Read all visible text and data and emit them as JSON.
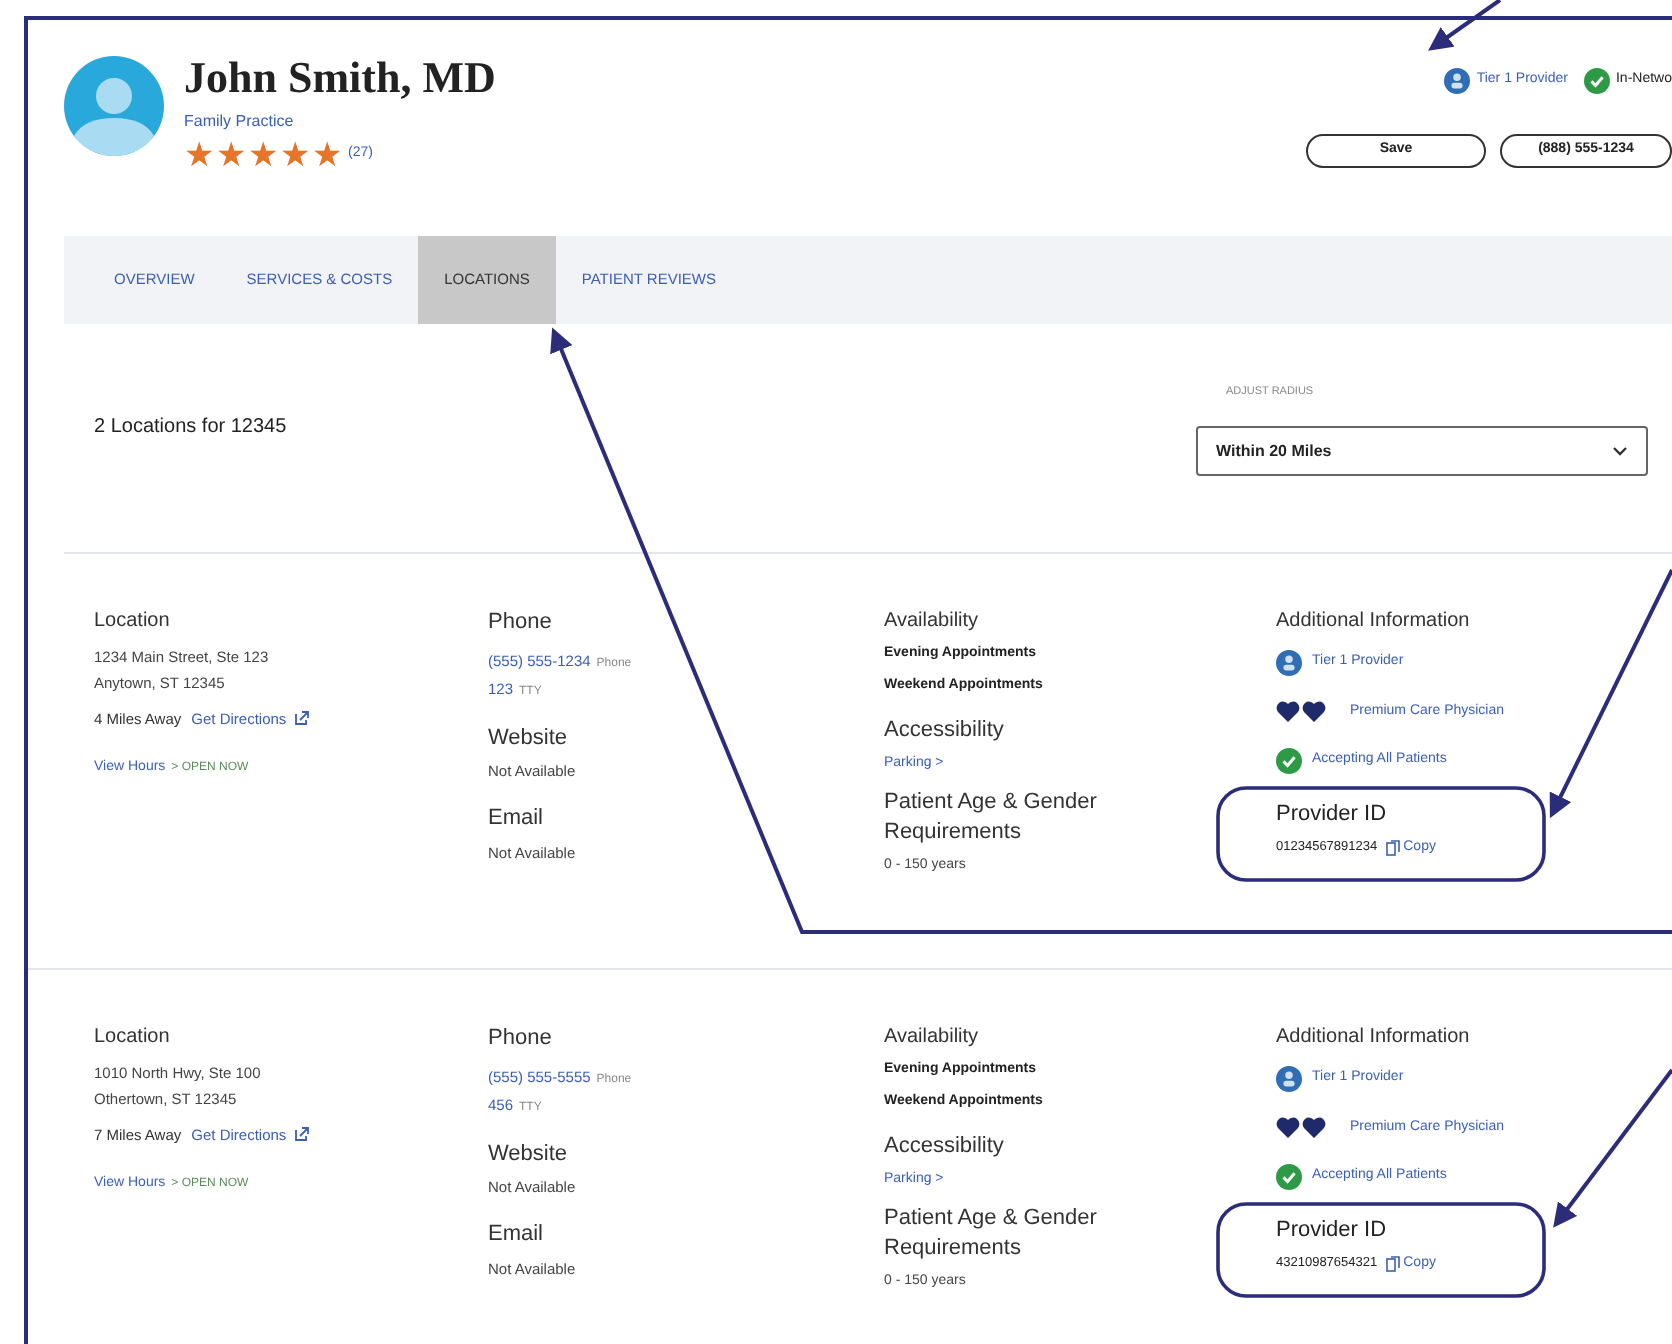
{
  "header": {
    "name": "John Smith, MD",
    "specialty": "Family Practice",
    "stars": 5,
    "review_count": "(27)",
    "badges": [
      {
        "kind": "tier",
        "label": "Tier 1 Provider"
      },
      {
        "kind": "network",
        "label": "In-Netwo"
      }
    ],
    "buttons": [
      "Save",
      "(888) 555-1234"
    ]
  },
  "tabs": [
    {
      "label": "OVERVIEW",
      "selected": false
    },
    {
      "label": "SERVICES & COSTS",
      "selected": false
    },
    {
      "label": "LOCATIONS",
      "selected": true
    },
    {
      "label": "PATIENT REVIEWS",
      "selected": false
    }
  ],
  "results": {
    "summary": "2 Locations for 12345",
    "radius_label": "ADJUST RADIUS",
    "radius_value": "Within 20 Miles"
  },
  "locations": [
    {
      "location_label": "Location",
      "address": [
        "1234 Main Street, Ste 123",
        "Anytown, ST 12345"
      ],
      "distance": "4 Miles Away",
      "directions": "Get Directions",
      "hours": "View Hours",
      "open_status": "> OPEN NOW",
      "phone_label": "Phone",
      "phone": "(555) 555-1234",
      "phone_type": "Phone",
      "tty": "123",
      "tty_label": "TTY",
      "website_label": "Website",
      "website": "Not Available",
      "email_label": "Email",
      "email": "Not Available",
      "availability_label": "Availability",
      "availability": [
        "Evening Appointments",
        "Weekend Appointments"
      ],
      "accessibility_label": "Accessibility",
      "accessibility": "Parking >",
      "age_label": "Patient Age & Gender Requirements",
      "age": "0 - 150 years",
      "info_label": "Additional Information",
      "info": [
        {
          "kind": "tier",
          "label": "Tier 1 Provider"
        },
        {
          "kind": "premium",
          "label": "Premium Care Physician"
        },
        {
          "kind": "accepting",
          "label": "Accepting All Patients"
        }
      ],
      "provider_id_label": "Provider ID",
      "provider_id": "01234567891234",
      "copy": "Copy"
    },
    {
      "location_label": "Location",
      "address": [
        "1010 North Hwy, Ste 100",
        "Othertown, ST 12345"
      ],
      "distance": "7 Miles Away",
      "directions": "Get Directions",
      "hours": "View Hours",
      "open_status": "> OPEN NOW",
      "phone_label": "Phone",
      "phone": "(555) 555-5555",
      "phone_type": "Phone",
      "tty": "456",
      "tty_label": "TTY",
      "website_label": "Website",
      "website": "Not Available",
      "email_label": "Email",
      "email": "Not Available",
      "availability_label": "Availability",
      "availability": [
        "Evening Appointments",
        "Weekend Appointments"
      ],
      "accessibility_label": "Accessibility",
      "accessibility": "Parking >",
      "age_label": "Patient Age & Gender Requirements",
      "age": "0 - 150 years",
      "info_label": "Additional Information",
      "info": [
        {
          "kind": "tier",
          "label": "Tier 1 Provider"
        },
        {
          "kind": "premium",
          "label": "Premium Care Physician"
        },
        {
          "kind": "accepting",
          "label": "Accepting All Patients"
        }
      ],
      "provider_id_label": "Provider ID",
      "provider_id": "43210987654321",
      "copy": "Copy"
    }
  ]
}
